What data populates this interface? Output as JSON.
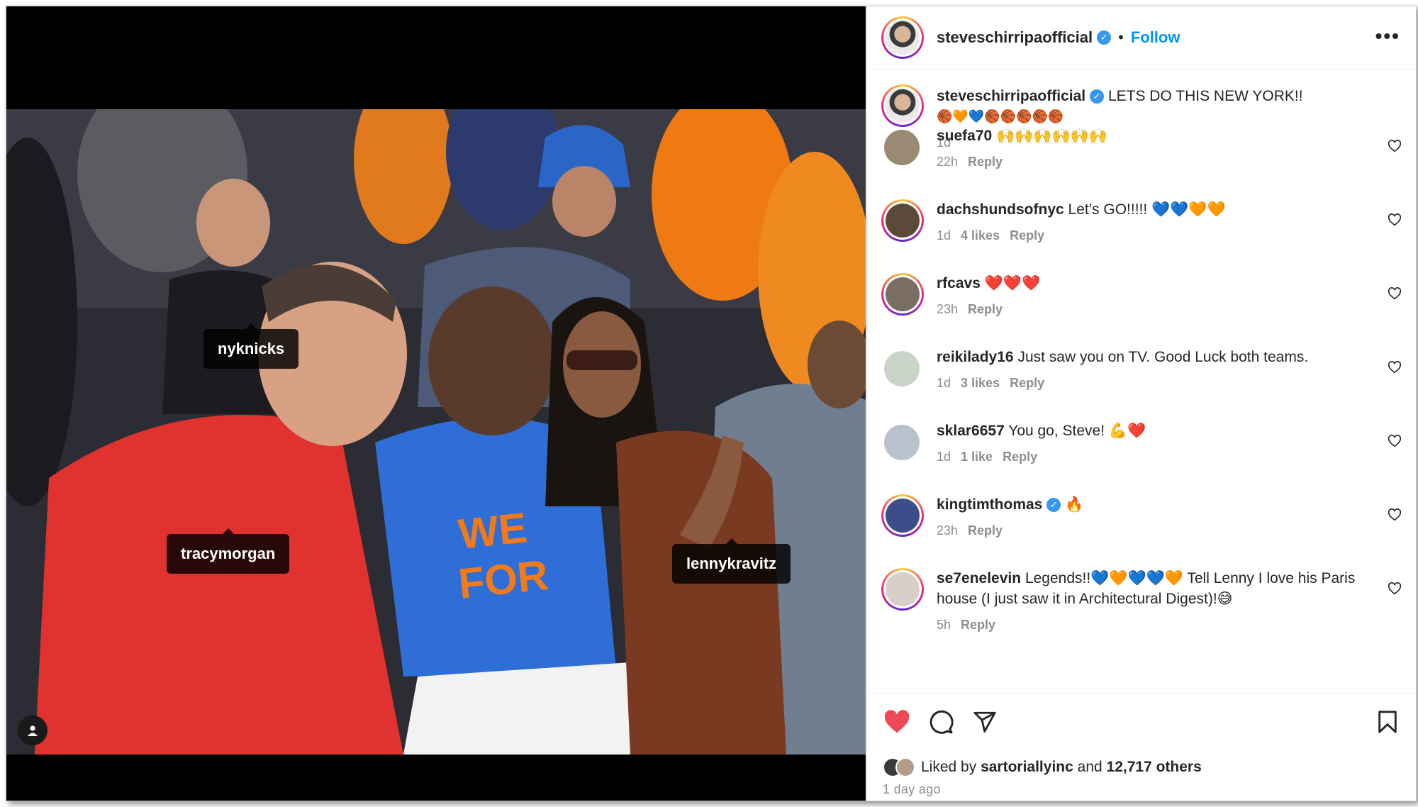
{
  "post": {
    "username": "steveschirripaofficial",
    "follow_label": "Follow",
    "separator": "•",
    "more_label": "•••",
    "caption": "LETS DO THIS NEW YORK!!",
    "caption_emojis": "🏀🧡💙🏀🏀🏀🏀🏀",
    "caption_time": "1d"
  },
  "photo_tags": [
    {
      "label": "nyknicks"
    },
    {
      "label": "tracymorgan"
    },
    {
      "label": "lennykravitz"
    }
  ],
  "comments": [
    {
      "user": "suefa70",
      "text": "🙌🙌🙌🙌🙌🙌",
      "verified": false,
      "time": "22h",
      "likes": "",
      "reply": "Reply",
      "avatar_color": "#9b8a73"
    },
    {
      "user": "dachshundsofnyc",
      "text": "Let’s GO!!!!! 💙💙🧡🧡",
      "verified": false,
      "time": "1d",
      "likes": "4 likes",
      "reply": "Reply",
      "avatar_color": "#5b4a3a"
    },
    {
      "user": "rfcavs",
      "text": "❤️❤️❤️",
      "verified": false,
      "time": "23h",
      "likes": "",
      "reply": "Reply",
      "avatar_color": "#7a6e64"
    },
    {
      "user": "reikilady16",
      "text": "Just saw you on TV. Good Luck both teams.",
      "verified": false,
      "time": "1d",
      "likes": "3 likes",
      "reply": "Reply",
      "avatar_color": "#c8d4c8"
    },
    {
      "user": "sklar6657",
      "text": "You go, Steve! 💪❤️",
      "verified": false,
      "time": "1d",
      "likes": "1 like",
      "reply": "Reply",
      "avatar_color": "#b9c2cc"
    },
    {
      "user": "kingtimthomas",
      "text": "🔥",
      "verified": true,
      "time": "23h",
      "likes": "",
      "reply": "Reply",
      "avatar_color": "#3b4e8a"
    },
    {
      "user": "se7enelevin",
      "text": "Legends!!💙🧡💙💙🧡 Tell Lenny I love his Paris house (I just saw it in Architectural Digest)!😅",
      "verified": false,
      "time": "5h",
      "likes": "",
      "reply": "Reply",
      "avatar_color": "#d8d0c8"
    }
  ],
  "footer": {
    "liked_prefix": "Liked by",
    "liked_user": "sartoriallyinc",
    "liked_and": "and",
    "liked_count": "12,717 others",
    "posted_ago": "1 day ago"
  },
  "colors": {
    "accent": "#0095f6",
    "verified": "#3897f0",
    "like_red": "#ed4956"
  }
}
